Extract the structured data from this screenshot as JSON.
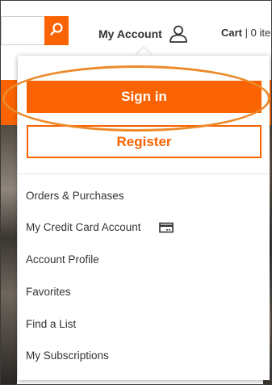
{
  "header": {
    "account_label": "My Account",
    "cart_label": "Cart",
    "cart_count": "| 0 ite"
  },
  "dropdown": {
    "signin_label": "Sign in",
    "register_label": "Register",
    "menu": [
      {
        "label": "Orders & Purchases"
      },
      {
        "label": "My Credit Card Account"
      },
      {
        "label": "Account Profile"
      },
      {
        "label": "Favorites"
      },
      {
        "label": "Find a List"
      },
      {
        "label": "My Subscriptions"
      }
    ]
  },
  "icons": {
    "search": "search-icon",
    "account": "user-icon",
    "credit_card": "credit-card-icon"
  },
  "colors": {
    "brand_orange": "#f96302",
    "annotation": "#ec8a2a",
    "text": "#333333"
  }
}
